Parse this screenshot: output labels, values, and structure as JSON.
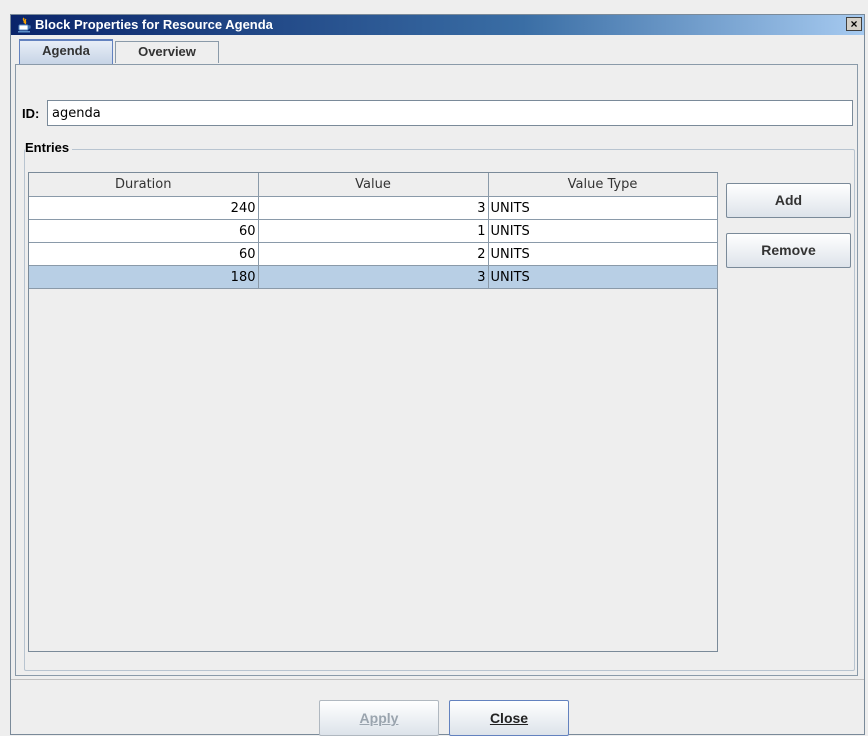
{
  "window": {
    "title": "Block Properties for Resource Agenda",
    "close_glyph": "×"
  },
  "tabs": [
    {
      "label": "Agenda",
      "active": true
    },
    {
      "label": "Overview",
      "active": false
    }
  ],
  "form": {
    "id_label": "ID:",
    "id_value": "agenda"
  },
  "entries": {
    "legend": "Entries",
    "columns": [
      "Duration",
      "Value",
      "Value Type"
    ],
    "rows": [
      {
        "duration": "240",
        "value": "3",
        "value_type": "UNITS",
        "selected": false
      },
      {
        "duration": "60",
        "value": "1",
        "value_type": "UNITS",
        "selected": false
      },
      {
        "duration": "60",
        "value": "2",
        "value_type": "UNITS",
        "selected": false
      },
      {
        "duration": "180",
        "value": "3",
        "value_type": "UNITS",
        "selected": true
      }
    ],
    "add_label": "Add",
    "remove_label": "Remove"
  },
  "footer": {
    "apply_label": "Apply",
    "close_label": "Close"
  },
  "colors": {
    "selection": "#b8cfe5",
    "titlebar": "#0a246a"
  }
}
